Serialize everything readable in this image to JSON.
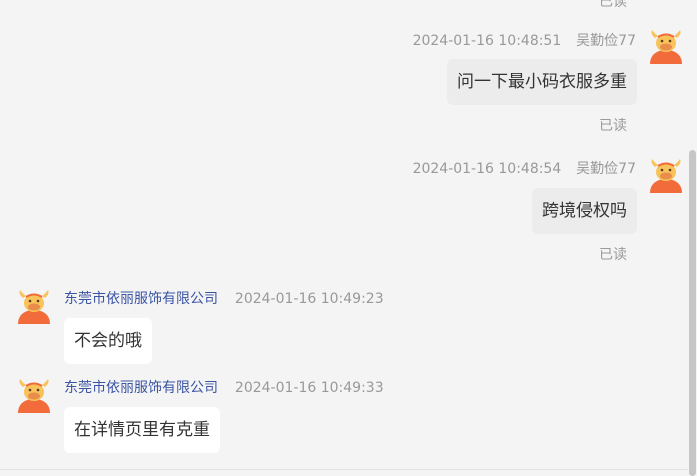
{
  "top_partial": {
    "read_label": "已读"
  },
  "messages": [
    {
      "direction": "out",
      "time": "2024-01-16 10:48:51",
      "sender": "吴勤俭77",
      "text": "问一下最小码衣服多重",
      "status": "已读"
    },
    {
      "direction": "out",
      "time": "2024-01-16 10:48:54",
      "sender": "吴勤俭77",
      "text": "跨境侵权吗",
      "status": "已读"
    },
    {
      "direction": "in",
      "sender": "东莞市依丽服饰有限公司",
      "time": "2024-01-16 10:49:23",
      "text": "不会的哦"
    },
    {
      "direction": "in",
      "sender": "东莞市依丽服饰有限公司",
      "time": "2024-01-16 10:49:33",
      "text": "在详情页里有克重"
    }
  ],
  "avatar_icon": "cartoon-cow-avatar-icon",
  "colors": {
    "background": "#f4f4f5",
    "outgoing_bubble": "#ececec",
    "incoming_bubble": "#ffffff",
    "company_name": "#3a54a4",
    "meta_text": "#999999",
    "avatar_orange": "#f26b3a",
    "avatar_yellow": "#f7c35a"
  }
}
